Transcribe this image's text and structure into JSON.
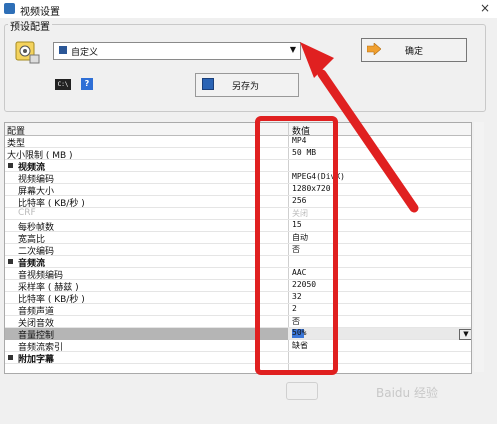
{
  "window": {
    "title": "视频设置",
    "close_symbol": "×"
  },
  "preset": {
    "group_title": "预设配置",
    "combo_value": "自定义",
    "combo_arrow": "▼",
    "ok_label": "确定",
    "saveas_label": "另存为",
    "icon_a_text": "C:\\",
    "icon_b_text": "?"
  },
  "grid": {
    "header_label": "配置",
    "header_value": "数值",
    "rows": [
      {
        "label": "类型",
        "value": "MP4",
        "type": "top"
      },
      {
        "label": "大小限制 ( MB )",
        "value": "50 MB",
        "type": "top"
      },
      {
        "label": "视频流",
        "value": "",
        "type": "section"
      },
      {
        "label": "视频编码",
        "value": "MPEG4(DivX)",
        "type": "child"
      },
      {
        "label": "屏幕大小",
        "value": "1280x720",
        "type": "child"
      },
      {
        "label": "比特率 ( KB/秒 )",
        "value": "256",
        "type": "child"
      },
      {
        "label": "CRF",
        "value": "关闭",
        "type": "disabled"
      },
      {
        "label": "每秒帧数",
        "value": "15",
        "type": "child"
      },
      {
        "label": "宽高比",
        "value": "自动",
        "type": "child"
      },
      {
        "label": "二次编码",
        "value": "否",
        "type": "child"
      },
      {
        "label": "音频流",
        "value": "",
        "type": "section"
      },
      {
        "label": "音视频编码",
        "value": "AAC",
        "type": "child"
      },
      {
        "label": "采样率 ( 赫兹 )",
        "value": "22050",
        "type": "child"
      },
      {
        "label": "比特率 ( KB/秒 )",
        "value": "32",
        "type": "child"
      },
      {
        "label": "音频声道",
        "value": "2",
        "type": "child"
      },
      {
        "label": "关闭音效",
        "value": "否",
        "type": "child"
      },
      {
        "label": "音量控制",
        "value": "50%",
        "type": "selected"
      },
      {
        "label": "音频流索引",
        "value": "缺省",
        "type": "child"
      },
      {
        "label": "附加字幕",
        "value": "",
        "type": "section"
      }
    ],
    "dropdown_arrow": "▼"
  },
  "watermark": {
    "text": "Baidu 经验"
  },
  "colors": {
    "annotation_red": "#e02020",
    "accent_blue": "#3a76d8"
  }
}
